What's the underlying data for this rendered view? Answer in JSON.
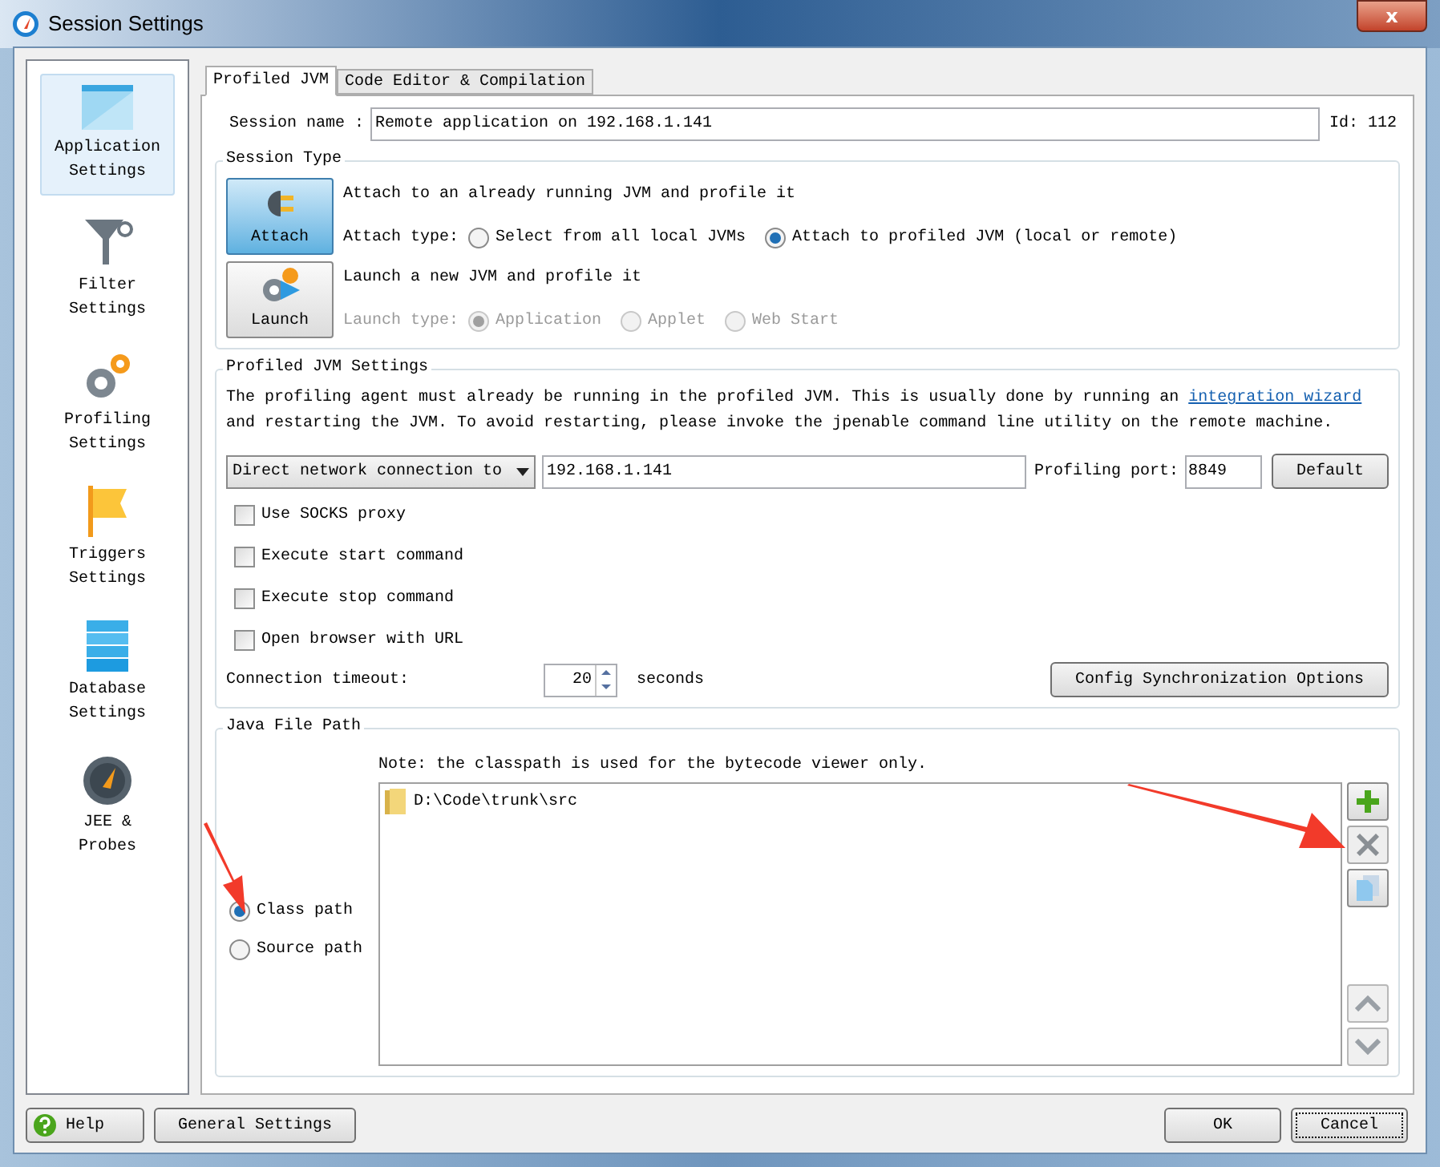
{
  "window": {
    "title": "Session Settings",
    "close": "x"
  },
  "sidebar": {
    "items": [
      {
        "kind": "application",
        "label": "Application Settings",
        "selected": true
      },
      {
        "kind": "filter",
        "label": "Filter Settings",
        "selected": false
      },
      {
        "kind": "profiling",
        "label": "Profiling Settings",
        "selected": false
      },
      {
        "kind": "triggers",
        "label": "Triggers Settings",
        "selected": false
      },
      {
        "kind": "database",
        "label": "Database Settings",
        "selected": false
      },
      {
        "kind": "jee",
        "label": "JEE & Probes",
        "selected": false
      }
    ]
  },
  "tabs": [
    {
      "label": "Profiled JVM",
      "selected": true
    },
    {
      "label": "Code Editor & Compilation",
      "selected": false
    }
  ],
  "session_name": {
    "label": "Session name :",
    "value": "Remote application on 192.168.1.141",
    "id": "Id: 112"
  },
  "session_type": {
    "title": "Session Type",
    "modes": [
      {
        "kind": "attach",
        "button": "Attach",
        "selected": true,
        "description": "Attach to an already running JVM and profile it",
        "type_label": "Attach type:",
        "disabled": false,
        "options": [
          {
            "label": "Select from all local JVMs",
            "selected": false
          },
          {
            "label": "Attach to profiled JVM (local or remote)",
            "selected": true
          }
        ]
      },
      {
        "kind": "launch",
        "button": "Launch",
        "selected": false,
        "description": "Launch a new JVM and profile it",
        "type_label": "Launch type:",
        "disabled": true,
        "options": [
          {
            "label": "Application",
            "selected": true
          },
          {
            "label": "Applet",
            "selected": false
          },
          {
            "label": "Web Start",
            "selected": false
          }
        ]
      }
    ]
  },
  "profiled_jvm_settings": {
    "title": "Profiled JVM Settings",
    "text_before": "The profiling agent must already be running in the profiled JVM. This is usually done by running an ",
    "link": "integration wizard",
    "text_after": " and restarting the JVM. To avoid restarting, please invoke the jpenable command line utility on the remote machine.",
    "connection": "Direct network connection to",
    "host": "192.168.1.141",
    "port_label": "Profiling port:",
    "port": "8849",
    "default_button": "Default",
    "checkboxes": [
      {
        "label": "Use SOCKS proxy",
        "checked": false
      },
      {
        "label": "Execute start command",
        "checked": false
      },
      {
        "label": "Execute stop command",
        "checked": false
      },
      {
        "label": "Open browser with URL",
        "checked": false
      }
    ],
    "timeout_label": "Connection timeout:",
    "timeout": "20",
    "timeout_unit": "seconds",
    "sync_button": "Config Synchronization Options"
  },
  "java_file_path": {
    "title": "Java File Path",
    "note": "Note: the classpath is used for the bytecode viewer only.",
    "path_types": [
      {
        "label": "Class path",
        "selected": true
      },
      {
        "label": "Source path",
        "selected": false
      }
    ],
    "entries": [
      {
        "label": "D:\\Code\\trunk\\src"
      }
    ]
  },
  "footer": {
    "help": "Help",
    "general_settings": "General Settings",
    "ok": "OK",
    "cancel": "Cancel"
  }
}
